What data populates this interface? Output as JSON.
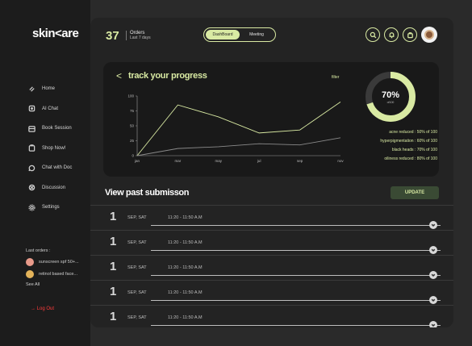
{
  "brand": {
    "logo": "skin<are"
  },
  "sidebar": {
    "items": [
      {
        "label": "Home",
        "icon": "home-icon"
      },
      {
        "label": "AI Chat",
        "icon": "ai-chat-icon"
      },
      {
        "label": "Book Session",
        "icon": "calendar-icon"
      },
      {
        "label": "Shop Now!",
        "icon": "shop-icon"
      },
      {
        "label": "Chat with Doc",
        "icon": "chat-icon"
      },
      {
        "label": "Discussion",
        "icon": "discussion-icon"
      },
      {
        "label": "Settings",
        "icon": "gear-icon"
      }
    ],
    "last_orders": {
      "title": "Last orders :",
      "items": [
        "sunscreen spf 50+...",
        "retinol based face..."
      ],
      "see_all": "See All"
    },
    "logout": "→ Log Out"
  },
  "header": {
    "orders_count": "37",
    "orders_label": "Orders",
    "orders_period": "Last 7 days",
    "tabs": [
      {
        "label": "DashBoard",
        "active": true
      },
      {
        "label": "Meeting",
        "active": false
      }
    ],
    "icons": [
      "search-icon",
      "bell-icon",
      "cart-icon"
    ]
  },
  "progress": {
    "back": "<",
    "title": "track your progress",
    "filter": "filter",
    "donut_value": "70%",
    "donut_sub": "of100",
    "stats": [
      "acne reduced : 50% of 100",
      "hyperpigmentation : 60% of 100",
      "black heads : 70% of 100",
      "oiliness reduced : 80% of 100"
    ]
  },
  "chart_data": {
    "type": "line",
    "categories": [
      "jan",
      "mar",
      "may",
      "jul",
      "sep",
      "nov"
    ],
    "y_ticks": [
      "100",
      "75",
      "50",
      "25",
      "0"
    ],
    "ylim": [
      0,
      100
    ],
    "series": [
      {
        "values": [
          0,
          85,
          65,
          38,
          43,
          90
        ],
        "color": "#d9eaa3"
      },
      {
        "values": [
          0,
          12,
          15,
          20,
          18,
          30
        ],
        "color": "#8a8a8a"
      }
    ],
    "title": "",
    "xlabel": "",
    "ylabel": ""
  },
  "submissions": {
    "title": "View past submisson",
    "update_label": "UPDATE",
    "rows": [
      {
        "num": "1",
        "date": "SEP, SAT",
        "time": "11:20 - 11:50 A.M"
      },
      {
        "num": "1",
        "date": "SEP, SAT",
        "time": "11:20 - 11:50 A.M"
      },
      {
        "num": "1",
        "date": "SEP, SAT",
        "time": "11:20 - 11:50 A.M"
      },
      {
        "num": "1",
        "date": "SEP, SAT",
        "time": "11:20 - 11:50 A.M"
      },
      {
        "num": "1",
        "date": "SEP, SAT",
        "time": "11:20 - 11:50 A.M"
      }
    ]
  },
  "colors": {
    "accent": "#d9eaa3",
    "background": "#2a2a2a",
    "panel": "#232323",
    "card": "#191919",
    "logout": "#ff3b3b"
  }
}
